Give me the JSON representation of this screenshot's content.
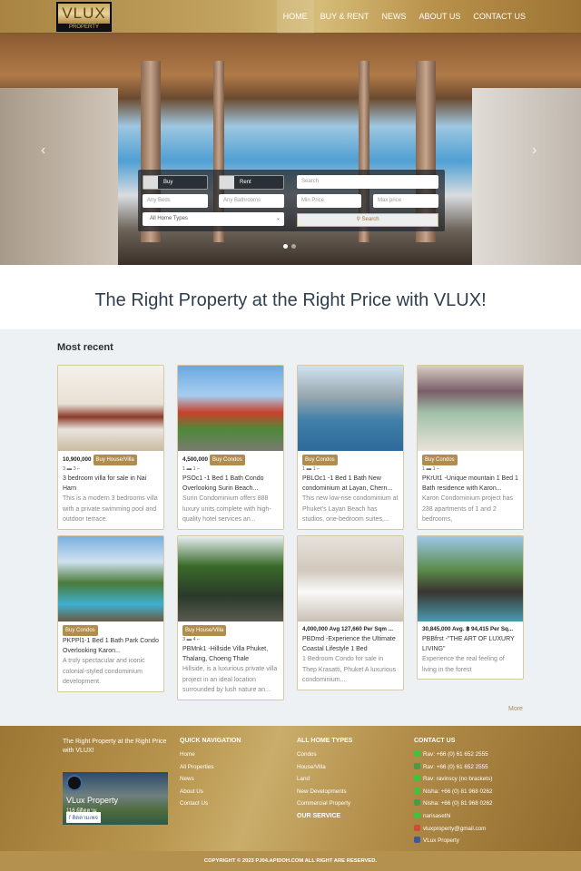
{
  "header": {
    "logo_text": "VLUX",
    "logo_sub": "PROPERTY",
    "nav": [
      "HOME",
      "BUY & RENT",
      "NEWS",
      "ABOUT US",
      "CONTACT US"
    ]
  },
  "search": {
    "buy": "Buy",
    "rent": "Rent",
    "search_placeholder": "Search",
    "beds_placeholder": "Any Beds",
    "baths_placeholder": "Any Bathrooms",
    "min_placeholder": "Min Price",
    "max_placeholder": "Max price",
    "home_type": "All Home Types",
    "search_button": "Search"
  },
  "tagline": "The Right Property at the Right Price with VLUX!",
  "recent": {
    "heading": "Most recent",
    "more": "More",
    "cards": [
      {
        "price": "10,900,000",
        "badge": "Buy House/Villa",
        "beds": "3",
        "baths": "3",
        "title": "3 bedroom villa for sale in Nai Harn",
        "desc": "This is a modern 3 bedrooms villa with a private swimming pool and outdoor terrace."
      },
      {
        "price": "4,500,000",
        "badge": "Buy Condos",
        "beds": "1",
        "baths": "1",
        "title": "PSOc1 -1 Bed 1 Bath Condo Overlooking Surin Beach...",
        "desc": "Surin Condominium offers 888 luxury units complete with high-quality hotel services an..."
      },
      {
        "price": "",
        "badge": "Buy Condos",
        "beds": "1",
        "baths": "1",
        "title": "PBLOc1 -1 Bed 1 Bath New condominium at Layan, Chern...",
        "desc": "This new low-rise condominium at Phuket's Layan Beach has studios, one-bedroom suites,..."
      },
      {
        "price": "",
        "badge": "Buy Condos",
        "beds": "1",
        "baths": "1",
        "title": "PKrUt1 -Unique mountain 1 Bed 1 Bath residence with Karon...",
        "desc": "Karon Condominium project has 238 apartments of 1 and 2 bedrooms,"
      },
      {
        "price": "",
        "badge": "Buy Condos",
        "beds": "",
        "baths": "",
        "title": "PKPPl1-1 Bed 1 Bath Park Condo Overlooking Karon...",
        "desc": "A truly spectacular and iconic colonial-styled condominium development."
      },
      {
        "price": "",
        "badge": "Buy House/Villa",
        "beds": "3",
        "baths": "4",
        "title": "PBMnk1 -Hillside Villa Phuket, Thalang, Choeng Thale",
        "desc": "Hillside, is a luxurious private villa project in an ideal location surrounded by lush nature an..."
      },
      {
        "price": "4,000,000 Avg 127,660 Per Sqm ...",
        "badge": "",
        "beds": "",
        "baths": "",
        "title": "PBDmd -Experience the Ultimate Coastal Lifestyle 1 Bed",
        "desc": "1 Bedroom Condo for sale in Thep Krasatti, Phuket A luxurious condominium..."
      },
      {
        "price": "30,845,000 Avg. ฿ 94,415 Per Sq...",
        "badge": "",
        "beds": "",
        "baths": "",
        "title": "PBBfrst -\"THE ART OF LUXURY LIVING\"",
        "desc": "Experience the real feeling of living in the forest"
      }
    ]
  },
  "footer": {
    "tagline": "The Right Property at the Right Price with VLUX!",
    "fb_name": "VLux Property",
    "fb_followers": "116 ผู้ติดตาม",
    "fb_follow": "ติดตามเพจ",
    "quick_heading": "QUICK NAVIGATION",
    "quick": [
      "Home",
      "All Properties",
      "News",
      "About Us",
      "Contact Us"
    ],
    "types_heading": "ALL HOME TYPES",
    "types": [
      "Condos",
      "House/Villa",
      "Land",
      "New Developments",
      "Commercial Property"
    ],
    "service_heading": "OUR SERVICE",
    "contact_heading": "CONTACT US",
    "contacts": [
      {
        "icon": "phone-icon",
        "color": "#3cc43c",
        "text": "Rav: +66 (0) 61 652 2555"
      },
      {
        "icon": "phone-icon",
        "color": "#4a9a4a",
        "text": "Rav: +66 (0) 61 652 2555"
      },
      {
        "icon": "line-icon",
        "color": "#3cc43c",
        "text": "Rav: ravinscy (no brackets)"
      },
      {
        "icon": "phone-icon",
        "color": "#3cc43c",
        "text": "Nisha: +66 (0) 81 968 0262"
      },
      {
        "icon": "phone-icon",
        "color": "#4a9a4a",
        "text": "Nisha: +66 (0) 81 968 0262"
      },
      {
        "icon": "line-icon",
        "color": "#3cc43c",
        "text": "narisasethi"
      },
      {
        "icon": "mail-icon",
        "color": "#d44a3a",
        "text": "vluxproperty@gmail.com"
      },
      {
        "icon": "facebook-icon",
        "color": "#3b5998",
        "text": "VLux Property"
      }
    ],
    "copyright": "COPYRIGHT © 2023 PJ04.APIDOH.COM ALL RIGHT ARE RESERVED."
  },
  "colors": {
    "gold": "#b08c4f",
    "title": "#2f3e4e"
  }
}
